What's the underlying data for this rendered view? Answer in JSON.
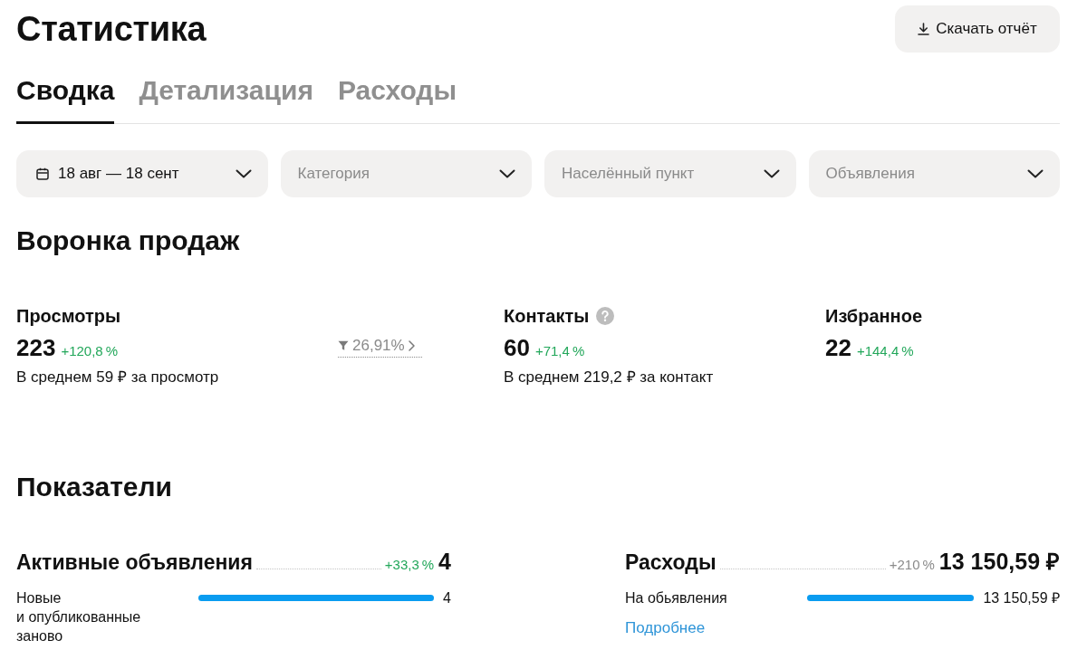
{
  "header": {
    "title": "Статистика",
    "download_button": "Скачать отчёт"
  },
  "tabs": [
    {
      "label": "Сводка",
      "selected": true
    },
    {
      "label": "Детализация",
      "selected": false
    },
    {
      "label": "Расходы",
      "selected": false
    }
  ],
  "filters": [
    {
      "kind": "date",
      "value": "18 авг — 18 сент"
    },
    {
      "kind": "select",
      "placeholder": "Категория"
    },
    {
      "kind": "select",
      "placeholder": "Населённый пункт"
    },
    {
      "kind": "select",
      "placeholder": "Объявления"
    }
  ],
  "funnel": {
    "title": "Воронка продаж",
    "steps": [
      {
        "label": "Просмотры",
        "help": false,
        "value": "223",
        "change": "+120,8 %",
        "note": "В среднем 59 ₽ за просмотр",
        "conversion": "26,91%"
      },
      {
        "label": "Контакты",
        "help": true,
        "value": "60",
        "change": "+71,4 %",
        "note": "В среднем 219,2 ₽ за контакт"
      },
      {
        "label": "Избранное",
        "help": false,
        "value": "22",
        "change": "+144,4 %"
      }
    ]
  },
  "indicators": {
    "title": "Показатели",
    "metrics": [
      {
        "kind": "growth",
        "title": "Активные объявления",
        "change": "+33,3 %",
        "total": "4",
        "rows": [
          {
            "label": "Новые и опубликованные заново",
            "level": 1,
            "value": "4"
          }
        ]
      },
      {
        "kind": "neutral",
        "title": "Расходы",
        "change": "+210 %",
        "total": "13 150,59 ₽",
        "rows": [
          {
            "label": "На обьявления",
            "level": 1,
            "value": "13 150,59 ₽"
          }
        ],
        "link": "Подробнее"
      }
    ]
  }
}
